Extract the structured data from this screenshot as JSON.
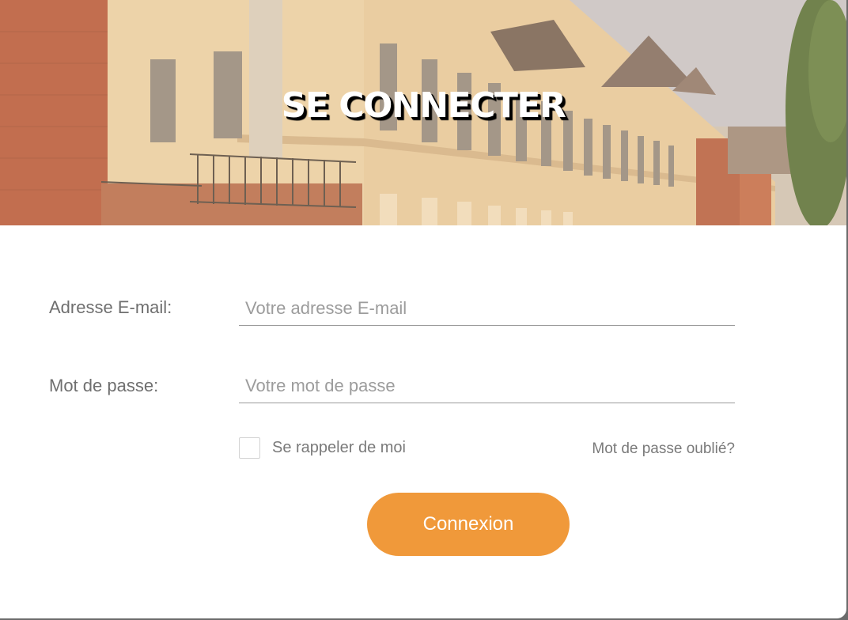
{
  "hero": {
    "title": "SE CONNECTER"
  },
  "form": {
    "email": {
      "label": "Adresse E-mail:",
      "placeholder": "Votre adresse E-mail",
      "value": ""
    },
    "password": {
      "label": "Mot de passe:",
      "placeholder": "Votre mot de passe",
      "value": ""
    },
    "remember": {
      "label": "Se rappeler de moi",
      "checked": false
    },
    "forgot_link": "Mot de passe oublié?",
    "submit_label": "Connexion"
  },
  "colors": {
    "accent": "#f0993a",
    "label_text": "#6f6f6f",
    "placeholder_text": "#9c9c9c",
    "background": "#ffffff"
  }
}
